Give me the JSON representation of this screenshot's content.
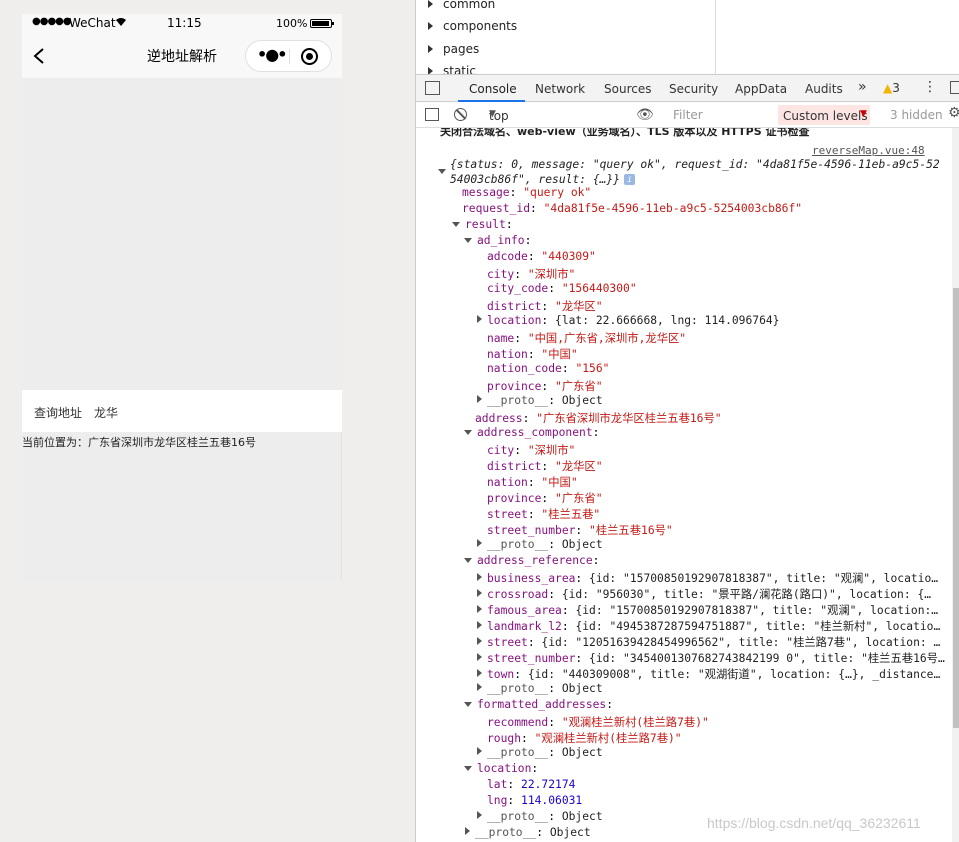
{
  "phone": {
    "signal": "●●●●●",
    "carrier": "WeChat",
    "time": "11:15",
    "battery_pct": "100%",
    "nav_title": "逆地址解析",
    "query_label": "查询地址",
    "query_value": "龙华",
    "result_text": "当前位置为：广东省深圳市龙华区桂兰五巷16号"
  },
  "filetree": [
    "common",
    "components",
    "pages",
    "static"
  ],
  "tabs": [
    "Console",
    "Network",
    "Sources",
    "Security",
    "AppData",
    "Audits"
  ],
  "tab_more": "»",
  "warnings": "3",
  "toolbar": {
    "context": "top",
    "filter_placeholder": "Filter",
    "levels": "Custom levels",
    "hidden": "3 hidden"
  },
  "console": {
    "truncated_msg": "关闭合法域名、web-view（业务域名）、TLS 版本以及 HTTPS 证书检查",
    "source_link": "reverseMap.vue:48",
    "summary_1": "{status: 0, message: \"query ok\", request_id: \"4da81f5e-4596-11eb-a9c5-52",
    "summary_2": "54003cb86f\", result: {…}}",
    "message": "\"query ok\"",
    "request_id": "\"4da81f5e-4596-11eb-a9c5-5254003cb86f\"",
    "ad_info": {
      "adcode": "\"440309\"",
      "city": "\"深圳市\"",
      "city_code": "\"156440300\"",
      "district": "\"龙华区\"",
      "location_preview": "{lat: 22.666668, lng: 114.096764}",
      "name": "\"中国,广东省,深圳市,龙华区\"",
      "nation": "\"中国\"",
      "nation_code": "\"156\"",
      "province": "\"广东省\""
    },
    "address": "\"广东省深圳市龙华区桂兰五巷16号\"",
    "address_component": {
      "city": "\"深圳市\"",
      "district": "\"龙华区\"",
      "nation": "\"中国\"",
      "province": "\"广东省\"",
      "street": "\"桂兰五巷\"",
      "street_number": "\"桂兰五巷16号\""
    },
    "address_reference": {
      "business_area": "{id: \"15700850192907818387\", title: \"观澜\", locatio…",
      "crossroad": "{id: \"956030\", title: \"景平路/澜花路(路口)\", location: {…",
      "famous_area": "{id: \"15700850192907818387\", title: \"观澜\", location:…",
      "landmark_l2": "{id: \"4945387287594751887\", title: \"桂兰新村\", locatio…",
      "street": "{id: \"12051639428454996562\", title: \"桂兰路7巷\", location: …",
      "street_number": "{id: \"3454001307682743842199 0\", title: \"桂兰五巷16号…",
      "town": "{id: \"440309008\", title: \"观湖街道\", location: {…}, _distance…"
    },
    "formatted_addresses": {
      "recommend": "\"观澜桂兰新村(桂兰路7巷)\"",
      "rough": "\"观澜桂兰新村(桂兰路7巷)\""
    },
    "location": {
      "lat": "22.72174",
      "lng": "114.06031"
    },
    "proto": "__proto__",
    "object": "Object"
  },
  "watermark": "https://blog.csdn.net/qq_36232611"
}
